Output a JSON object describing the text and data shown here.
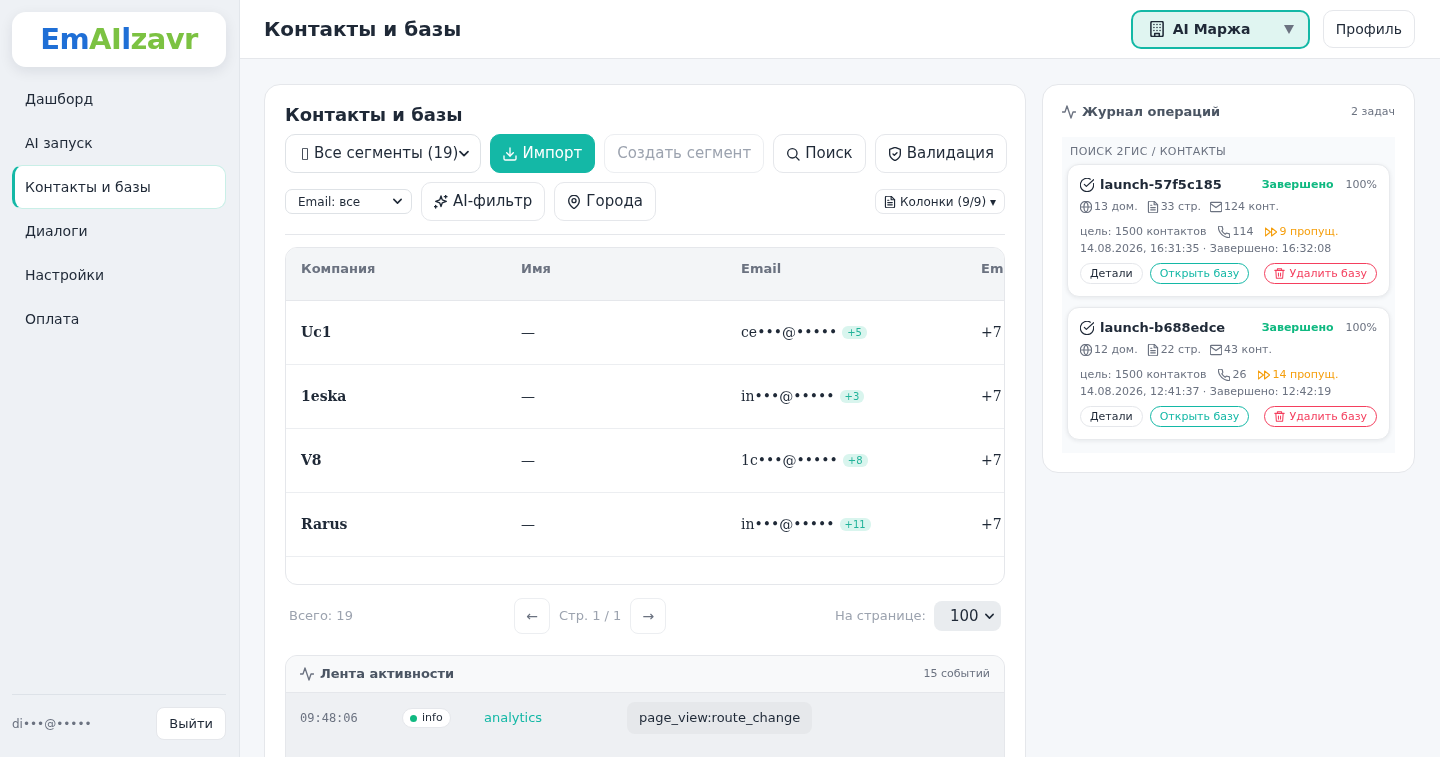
{
  "sidebar": {
    "logo": "EmAIlzavr",
    "items": [
      {
        "label": "Дашборд",
        "selected": false
      },
      {
        "label": "AI запуск",
        "selected": false
      },
      {
        "label": "Контакты и базы",
        "selected": true
      },
      {
        "label": "Диалоги",
        "selected": false
      },
      {
        "label": "Настройки",
        "selected": false
      },
      {
        "label": "Оплата",
        "selected": false
      }
    ],
    "user": "di•••@•••••",
    "logout": "Выйти"
  },
  "header": {
    "title": "Контакты и базы",
    "workspace": "AI Маржа",
    "profile": "Профиль"
  },
  "contacts": {
    "title": "Контакты и базы",
    "toolbar": [
      [
        {
          "kind": "select",
          "label": "▯ Все сегменты (19)"
        },
        {
          "kind": "primary",
          "label": "Импорт",
          "disabled": false
        },
        {
          "kind": "outline",
          "label": "Создать сегмент",
          "disabled": true
        },
        {
          "kind": "outline",
          "label": "Поиск",
          "disabled": false
        },
        {
          "kind": "outline",
          "label": "Валидация",
          "disabled": false
        }
      ],
      [
        {
          "kind": "select-small",
          "label": "Email: все"
        },
        {
          "kind": "outline",
          "label": "AI-фильтр",
          "disabled": false
        },
        {
          "kind": "outline",
          "label": "Города",
          "disabled": false
        },
        {
          "kind": "small",
          "label": "Колонки (9/9) ▾",
          "disabled": false
        }
      ]
    ],
    "table": {
      "columns": [
        "Компания",
        "Имя",
        "Email",
        "Em"
      ],
      "rows": [
        {
          "company": "Uc1",
          "name": "—",
          "email": "ce•••@•••••",
          "email_more": "+5",
          "column_4": "+7"
        },
        {
          "company": "1eska",
          "name": "—",
          "email": "in•••@•••••",
          "email_more": "+3",
          "column_4": "+7"
        },
        {
          "company": "V8",
          "name": "—",
          "email": "1c•••@•••••",
          "email_more": "+8",
          "column_4": "+7"
        },
        {
          "company": "Rarus",
          "name": "—",
          "email": "in•••@•••••",
          "email_more": "+11",
          "column_4": "+7"
        }
      ]
    },
    "pagination": {
      "total": "Всего: 19",
      "prev": "←",
      "page": "Стр. 1 / 1",
      "next": "→",
      "per_page_label": "На странице:",
      "per_page": "100"
    }
  },
  "activity": {
    "title": "Лента активности",
    "count": "15 событий",
    "events": [
      {
        "time": "09:48:06",
        "level": "info",
        "color": "#10b981",
        "source": "analytics",
        "event": "page_view:route_change"
      }
    ]
  },
  "operations": {
    "title": "Журнал операций",
    "count": "2 задач",
    "section": "ПОИСК 2ГИС / КОНТАКТЫ",
    "tasks": [
      {
        "name": "launch-57f5c185",
        "status": "Завершено",
        "progress": "100%",
        "domains": "13 дом.",
        "pages": "33 стр.",
        "contacts": "124 конт.",
        "goal": "цель: 1500 контактов",
        "phones": "114",
        "skipped": "9 пропущ.",
        "time": "14.08.2026, 16:31:35 · Завершено: 16:32:08",
        "buttons": [
          {
            "kind": "neutral",
            "label": "Детали"
          },
          {
            "kind": "open",
            "label": "Открыть базу"
          },
          {
            "kind": "danger",
            "label": "Удалить базу"
          }
        ]
      },
      {
        "name": "launch-b688edce",
        "status": "Завершено",
        "progress": "100%",
        "domains": "12 дом.",
        "pages": "22 стр.",
        "contacts": "43 конт.",
        "goal": "цель: 1500 контактов",
        "phones": "26",
        "skipped": "14 пропущ.",
        "time": "14.08.2026, 12:41:37 · Завершено: 12:42:19",
        "buttons": [
          {
            "kind": "neutral",
            "label": "Детали"
          },
          {
            "kind": "open",
            "label": "Открыть базу"
          },
          {
            "kind": "danger",
            "label": "Удалить базу"
          }
        ]
      }
    ]
  }
}
